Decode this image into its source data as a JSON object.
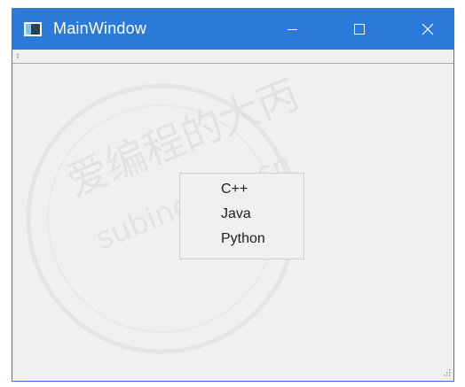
{
  "window": {
    "title": "MainWindow",
    "colors": {
      "titlebar": "#2b7ad9",
      "body": "#f0f0f0",
      "border": "#2b79d8"
    }
  },
  "titlebar_icons": [
    "app-icon",
    "minimize-icon",
    "maximize-icon",
    "close-icon"
  ],
  "list": {
    "items": [
      "C++",
      "Java",
      "Python"
    ]
  },
  "watermark": {
    "line1": "爱编程的大丙",
    "line2": "subingwen.cn"
  }
}
